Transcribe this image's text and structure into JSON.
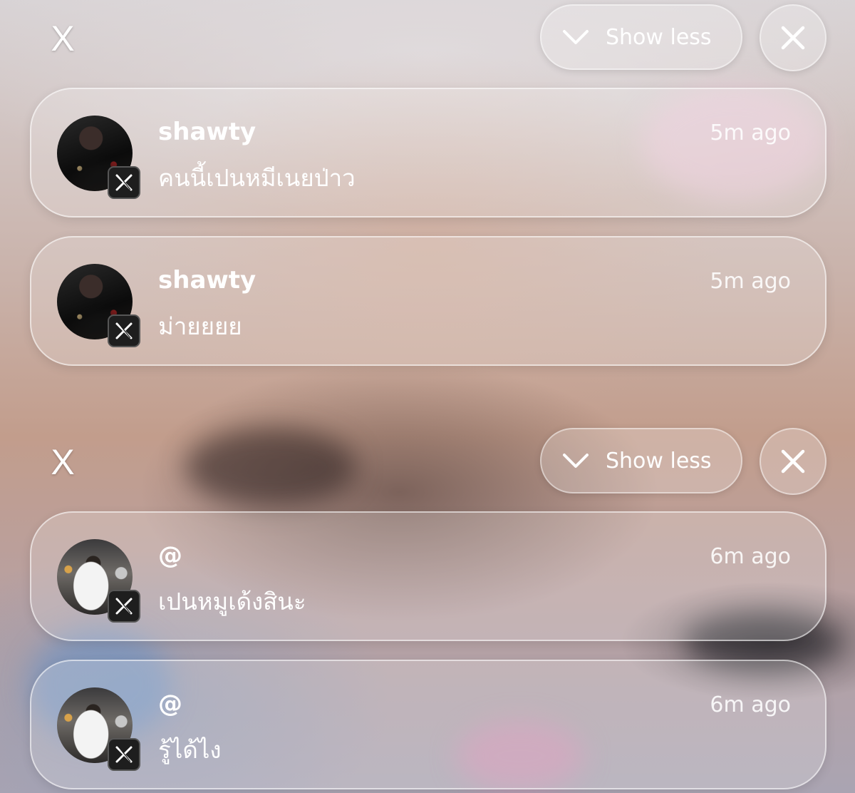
{
  "groups": [
    {
      "dismiss_label": "X",
      "show_less_label": "Show less",
      "notifications": [
        {
          "name": "shawty",
          "message": "คนนี้เปนหมีเนยป่าว",
          "time": "5m ago"
        },
        {
          "name": "shawty",
          "message": "ม่ายยยย",
          "time": "5m ago"
        }
      ]
    },
    {
      "dismiss_label": "X",
      "show_less_label": "Show less",
      "notifications": [
        {
          "name": "@",
          "message": "เปนหมูเด้งสินะ",
          "time": "6m ago"
        },
        {
          "name": "@",
          "message": "รู้ได้ไง",
          "time": "6m ago"
        }
      ]
    }
  ],
  "icons": {
    "chevron": "chevron-down-icon",
    "close": "close-icon",
    "app_badge": "x-logo-icon"
  }
}
